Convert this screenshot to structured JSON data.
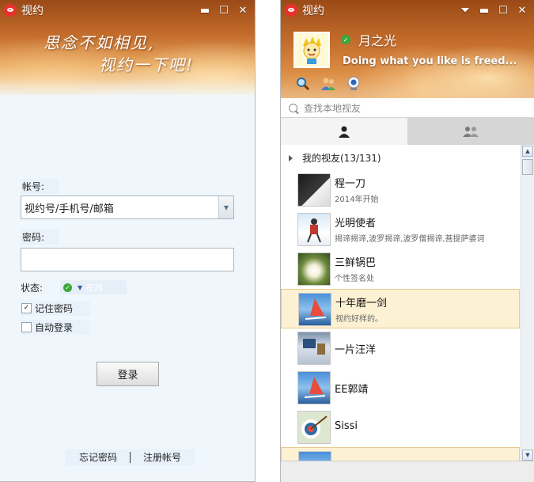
{
  "login": {
    "app_title": "视约",
    "slogan_line1": "思念不如相见,",
    "slogan_line2": "视约一下吧!",
    "account_label": "帐号:",
    "account_value": "视约号/手机号/邮箱",
    "password_label": "密码:",
    "password_value": "",
    "status_label": "状态:",
    "status_value": "在线",
    "remember_password": {
      "label": "记住密码",
      "checked": true
    },
    "auto_login": {
      "label": "自动登录",
      "checked": false
    },
    "login_button": "登录",
    "forgot_password": "忘记密码",
    "register": "注册帐号"
  },
  "main": {
    "app_title": "视约",
    "nickname": "月之光",
    "signature": "Doing what you like is freed...",
    "search_placeholder": "查找本地视友",
    "tabs": [
      {
        "icon": "person-icon",
        "active": true
      },
      {
        "icon": "group-icon",
        "active": false
      }
    ],
    "group": {
      "name": "我的视友(13/131)"
    },
    "friends": [
      {
        "name": "程一刀",
        "signature": "2014年开始",
        "avatar": "eagle"
      },
      {
        "name": "光明使者",
        "signature": "揭谛揭谛,波罗揭谛,波罗僧揭谛,菩提萨婆诃",
        "avatar": "skier"
      },
      {
        "name": "三鲜锅巴",
        "signature": "个性签名处",
        "avatar": "flower"
      },
      {
        "name": "十年磨一剑",
        "signature": "视约好样的。",
        "avatar": "windsurf",
        "selected": true
      },
      {
        "name": "一片汪洋",
        "signature": "",
        "avatar": "office"
      },
      {
        "name": "EE郭靖",
        "signature": "",
        "avatar": "windsurf"
      },
      {
        "name": "Sissi",
        "signature": "",
        "avatar": "target"
      }
    ]
  },
  "colors": {
    "banner_dark": "#9a4a17",
    "banner_light": "#e7a45a",
    "online_green": "#3aa83a",
    "selected_row": "#fdf1d3",
    "login_bg": "#f0f7fc"
  }
}
